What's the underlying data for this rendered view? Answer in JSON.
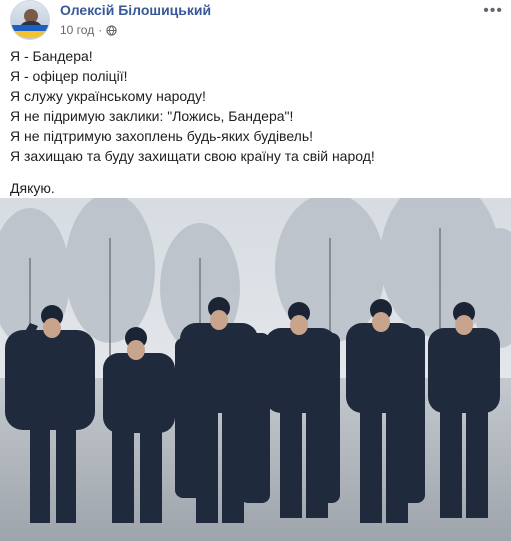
{
  "author": {
    "name": "Олексій Білошицький",
    "avatar_icon": "profile-photo"
  },
  "meta": {
    "timestamp": "10 год",
    "separator": "·",
    "audience_icon": "globe-icon"
  },
  "more_label": "•••",
  "post": {
    "lines": [
      "Я - Бандера!",
      "Я - офіцер поліції!",
      "Я служу українському народу!",
      "Я не підримую заклики: \"Ложись, Бандера\"!",
      "Я не підтримую захоплень будь-яких будівель!",
      "Я захищаю та буду захищати свою країну та свій народ!"
    ],
    "closing": "Дякую."
  },
  "photo": {
    "subject": "police-officers-in-formation",
    "colors": {
      "sky": "#dfe3e8",
      "uniform": "#1f2a3d",
      "ground": "#b9bec5"
    }
  }
}
